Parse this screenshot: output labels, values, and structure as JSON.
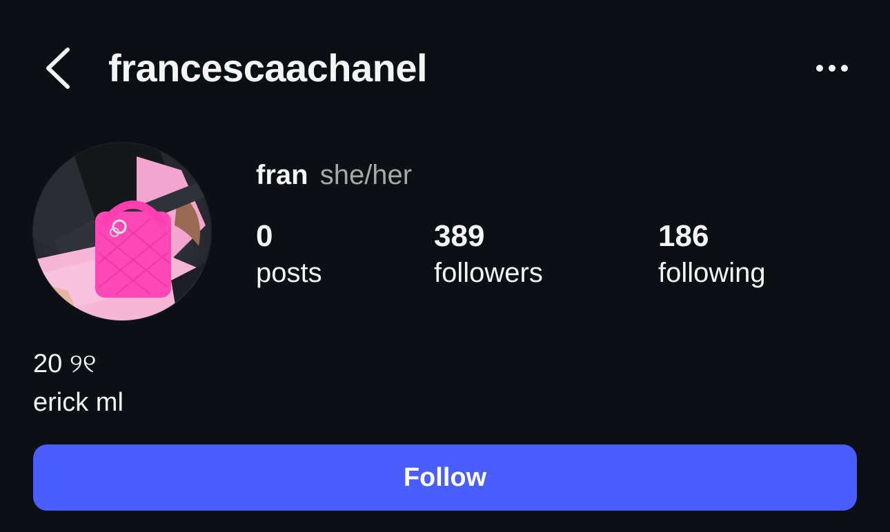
{
  "header": {
    "username": "francescaachanel",
    "back_icon": "chevron-left-icon",
    "more_icon": "more-horizontal-icon"
  },
  "profile": {
    "display_name": "fran",
    "pronouns": "she/her",
    "avatar_description_icon": "profile-avatar"
  },
  "stats": [
    {
      "value": "0",
      "label": "posts"
    },
    {
      "value": "389",
      "label": "followers"
    },
    {
      "value": "186",
      "label": "following"
    }
  ],
  "bio": {
    "line1": "20 ୨୧",
    "line2": "erick ml"
  },
  "actions": {
    "follow_label": "Follow"
  },
  "colors": {
    "background": "#0c1014",
    "accent": "#4a5dff",
    "text_primary": "#f5f5f5",
    "text_secondary": "#a8a8a8"
  }
}
